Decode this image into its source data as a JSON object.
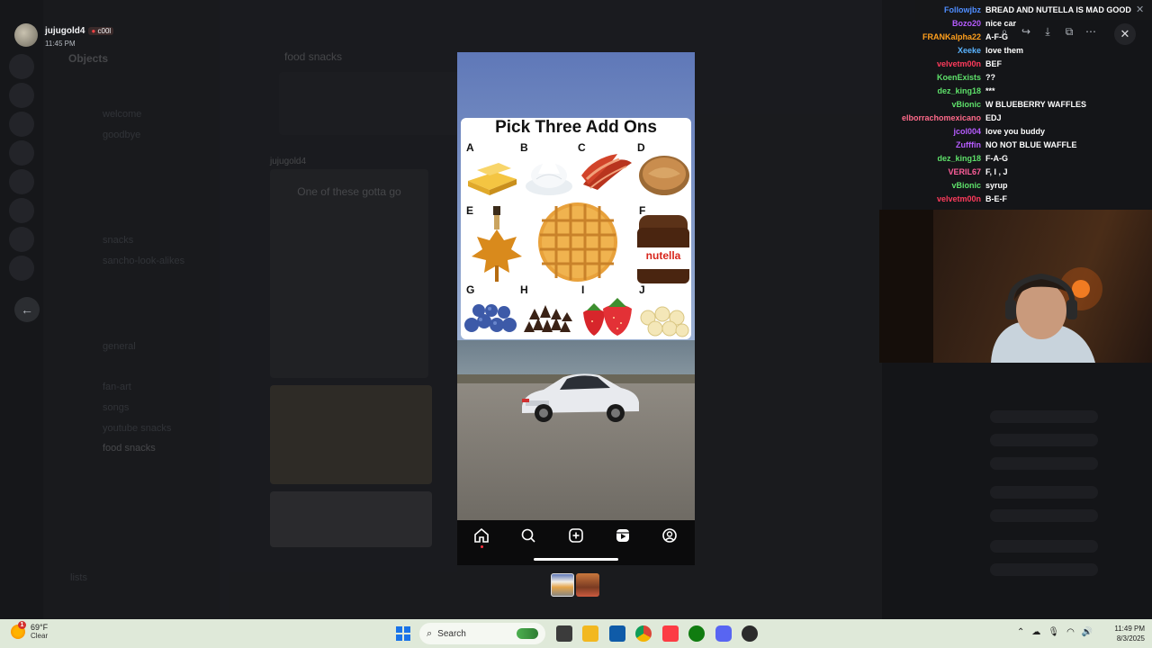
{
  "background": {
    "window_title": "Objects",
    "server_name": "Objects",
    "channel_title": "food snacks",
    "channels": [
      "welcome",
      "goodbye",
      "snacks",
      "sancho-look-alikes",
      "general",
      "fan-art",
      "songs",
      "youtube snacks",
      "food snacks",
      "lists"
    ],
    "post_text": "One of these gotta go",
    "post_author": "jujugold4"
  },
  "viewer": {
    "user": {
      "name": "jujugold4",
      "badge": "c00l",
      "time": "11:45 PM"
    },
    "toolbar_icons": [
      "zoom-icon",
      "forward-icon",
      "download-icon",
      "open-external-icon",
      "more-icon"
    ]
  },
  "post": {
    "title": "Pick Three Add Ons",
    "options": [
      {
        "letter": "A",
        "item": "butter"
      },
      {
        "letter": "B",
        "item": "whipped cream"
      },
      {
        "letter": "C",
        "item": "bacon"
      },
      {
        "letter": "D",
        "item": "peanut butter"
      },
      {
        "letter": "E",
        "item": "maple syrup"
      },
      {
        "letter": "F",
        "item": "nutella"
      },
      {
        "letter": "G",
        "item": "blueberries"
      },
      {
        "letter": "H",
        "item": "chocolate chips"
      },
      {
        "letter": "I",
        "item": "strawberries"
      },
      {
        "letter": "J",
        "item": "bananas"
      }
    ],
    "nutella_label": "nutella",
    "nav_icons": [
      "home-icon",
      "search-icon",
      "create-icon",
      "reels-icon",
      "profile-icon"
    ]
  },
  "chat": {
    "messages": [
      {
        "user": "Followjbz",
        "color": "#4f8dff",
        "text": "BREAD AND NUTELLA IS MAD GOOD"
      },
      {
        "user": "Bozo20",
        "color": "#b65cff",
        "text": "nice car"
      },
      {
        "user": "FRANKalpha22",
        "color": "#ff9f1c",
        "text": "A-F-G"
      },
      {
        "user": "Xeeke",
        "color": "#5ab4ff",
        "text": "love them"
      },
      {
        "user": "velvetm00n",
        "color": "#ff3b5c",
        "text": "BEF"
      },
      {
        "user": "KoenExists",
        "color": "#5ee06a",
        "text": "??"
      },
      {
        "user": "dez_king18",
        "color": "#5ee06a",
        "text": "***"
      },
      {
        "user": "vBionic",
        "color": "#5ee06a",
        "text": "W BLUEBERRY WAFFLES"
      },
      {
        "user": "elborrachomexicano",
        "color": "#ff6a8a",
        "text": "EDJ"
      },
      {
        "user": "jcol004",
        "color": "#b65cff",
        "text": "love you buddy"
      },
      {
        "user": "Zufffin",
        "color": "#b65cff",
        "text": "NO NOT BLUE WAFFLE"
      },
      {
        "user": "dez_king18",
        "color": "#5ee06a",
        "text": "F-A-G"
      },
      {
        "user": "VERIL67",
        "color": "#ff5e9a",
        "text": "F, I , J"
      },
      {
        "user": "vBionic",
        "color": "#5ee06a",
        "text": "syrup"
      },
      {
        "user": "velvetm00n",
        "color": "#ff3b5c",
        "text": "B-E-F"
      }
    ]
  },
  "taskbar": {
    "weather": {
      "temp": "69°F",
      "condition": "Clear",
      "alert": "1"
    },
    "search_placeholder": "Search",
    "time": "11:49 PM",
    "date": "8/3/2025"
  }
}
